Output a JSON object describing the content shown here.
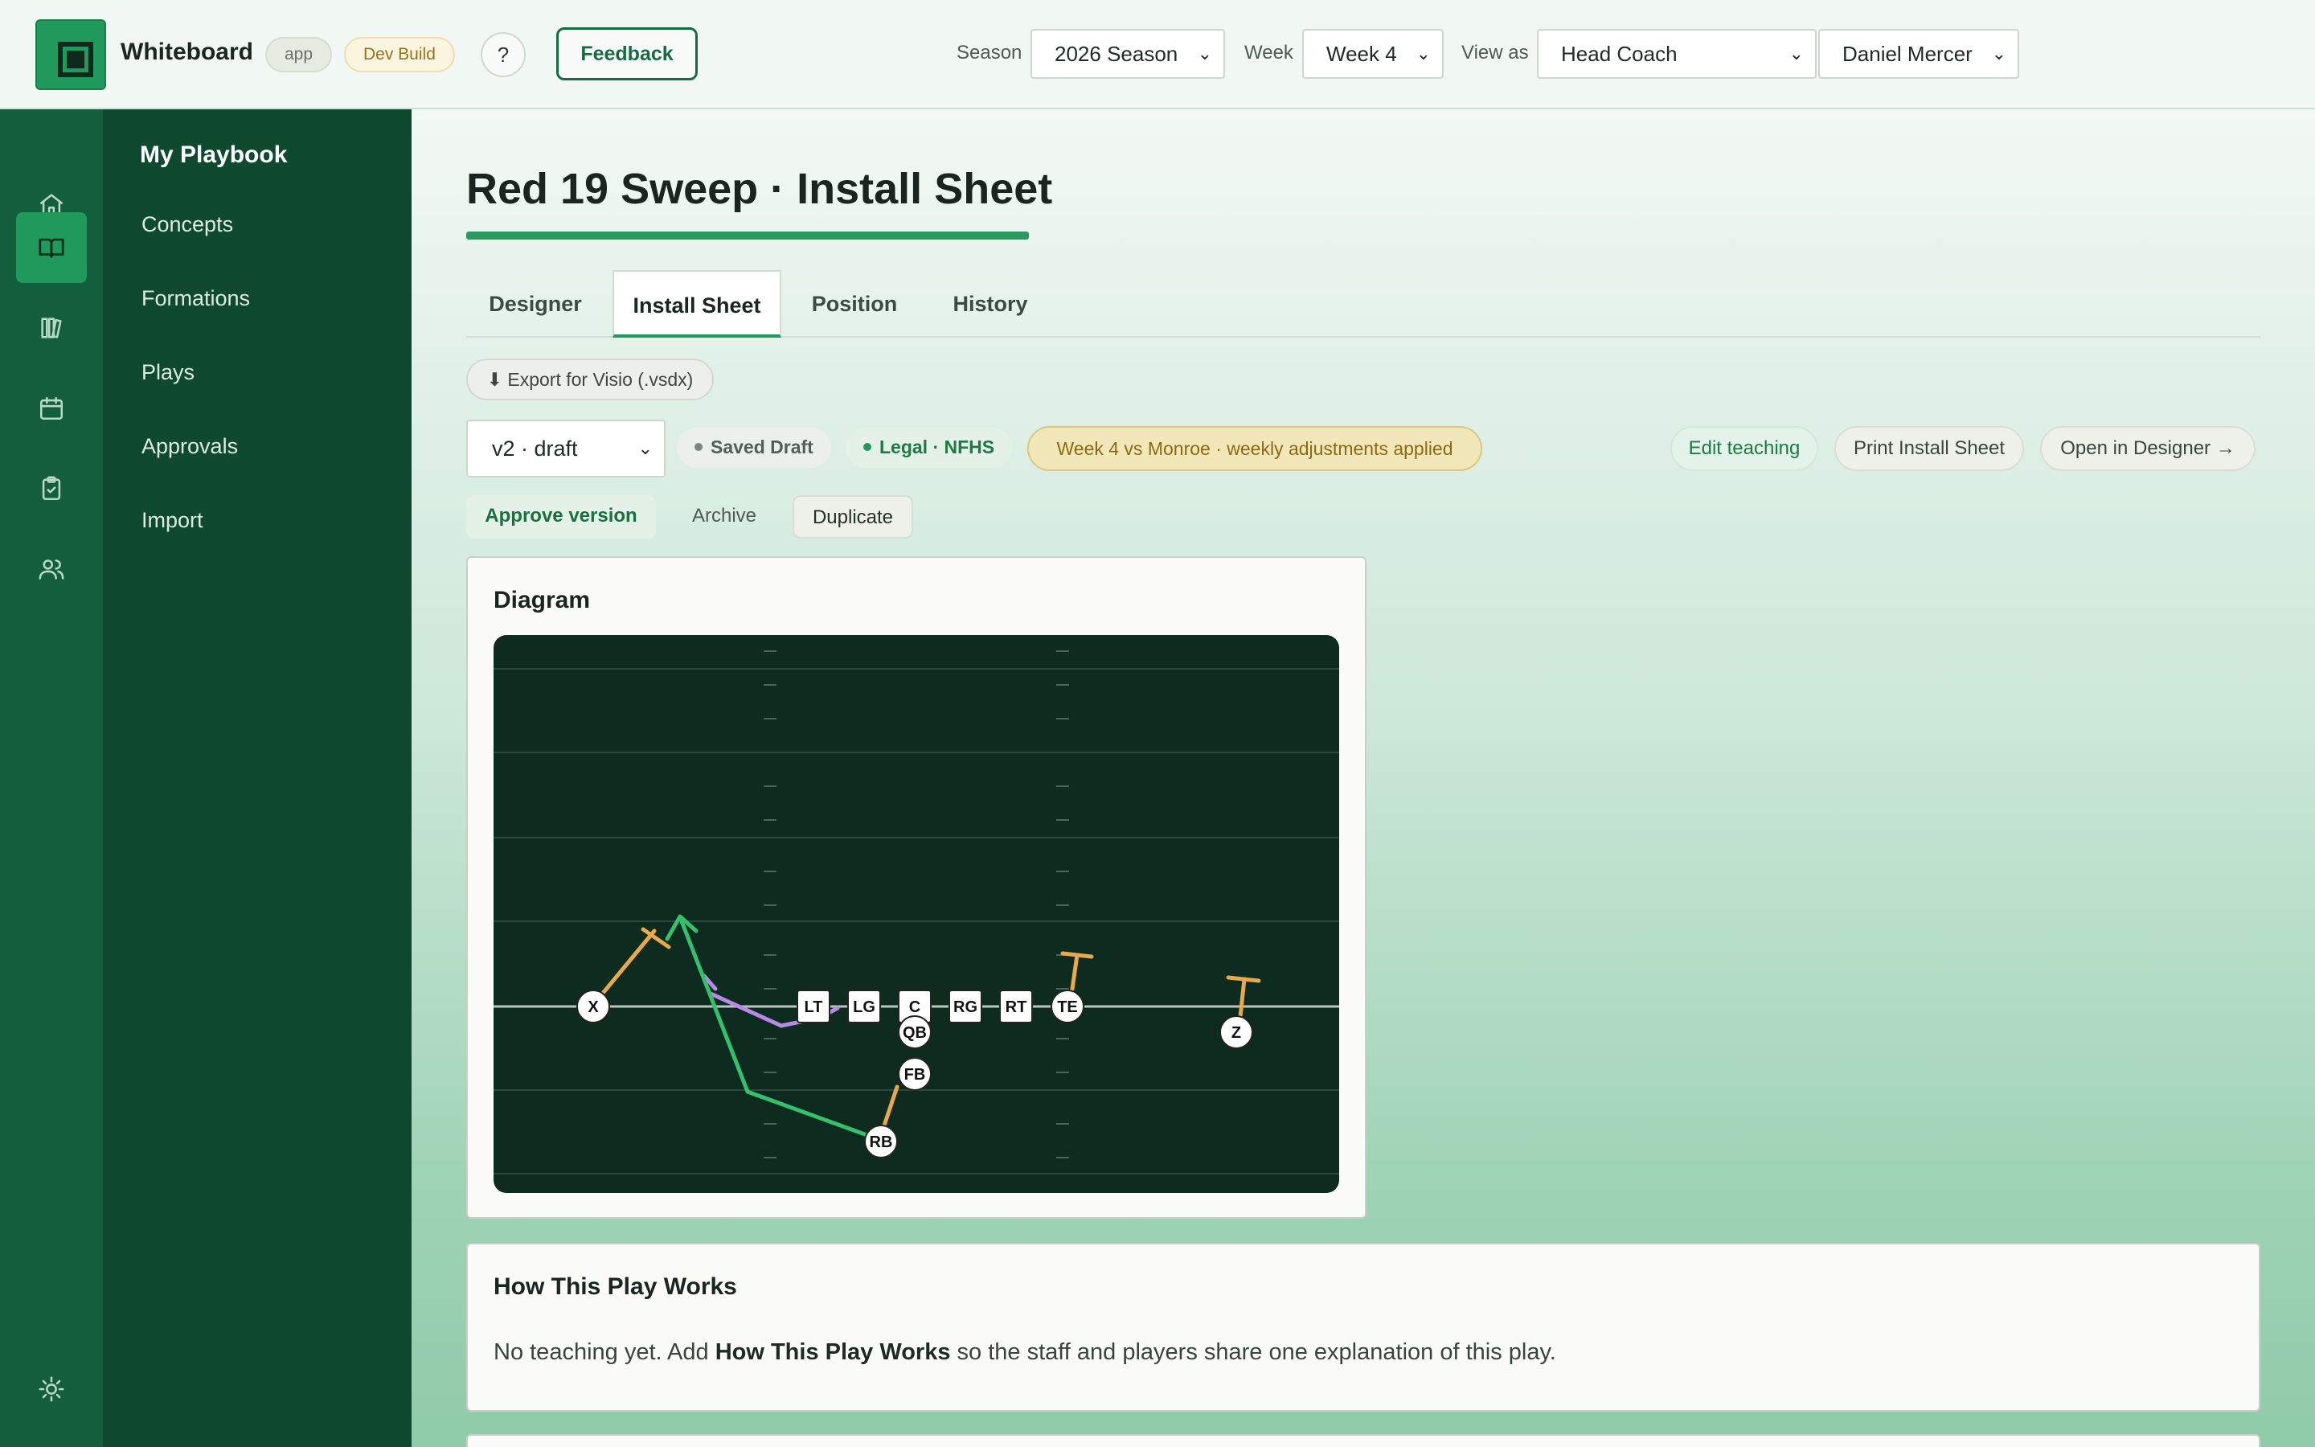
{
  "header": {
    "brand": "Whiteboard",
    "app_tag": "app",
    "build_tag": "Dev Build",
    "help_label": "?",
    "feedback_label": "Feedback",
    "season_label": "Season",
    "season_value": "2026 Season",
    "week_label": "Week",
    "week_value": "Week 4",
    "view_label": "View as",
    "view_value": "Head Coach",
    "user_value": "Daniel Mercer"
  },
  "rail": {
    "icons": [
      "home-icon",
      "book-icon",
      "library-icon",
      "calendar-icon",
      "clipboard-check-icon",
      "users-icon",
      "sun-icon"
    ],
    "active": "book-icon"
  },
  "sidebar": {
    "title": "My Playbook",
    "items": [
      {
        "label": "Concepts"
      },
      {
        "label": "Formations"
      },
      {
        "label": "Plays"
      },
      {
        "label": "Approvals"
      },
      {
        "label": "Import"
      }
    ]
  },
  "main": {
    "title": "Red 19 Sweep · Install Sheet",
    "tabs": [
      {
        "label": "Designer"
      },
      {
        "label": "Install Sheet"
      },
      {
        "label": "Position"
      },
      {
        "label": "History"
      }
    ],
    "active_tab": "Install Sheet",
    "export_label": "⬇ Export for Visio (.vsdx)",
    "version_value": "v2 · draft",
    "saved_badge": "Saved Draft",
    "legal_badge": "Legal · NFHS",
    "notice": "Week 4 vs Monroe · weekly adjustments applied",
    "edit_teaching": "Edit teaching",
    "print_sheet": "Print Install Sheet",
    "open_designer": "Open in Designer →",
    "approve": "Approve version",
    "archive": "Archive",
    "duplicate": "Duplicate",
    "diagram_title": "Diagram",
    "how_title": "How This Play Works",
    "how_text_1": "No teaching yet. Add ",
    "how_text_bold": "How This Play Works",
    "how_text_2": " so the staff and players share one explanation of this play."
  },
  "diagram": {
    "players": [
      {
        "label": "X",
        "shape": "circle"
      },
      {
        "label": "LT",
        "shape": "square"
      },
      {
        "label": "LG",
        "shape": "square"
      },
      {
        "label": "C",
        "shape": "square"
      },
      {
        "label": "RG",
        "shape": "square"
      },
      {
        "label": "RT",
        "shape": "square"
      },
      {
        "label": "TE",
        "shape": "circle"
      },
      {
        "label": "QB",
        "shape": "circle"
      },
      {
        "label": "FB",
        "shape": "circle"
      },
      {
        "label": "RB",
        "shape": "circle"
      },
      {
        "label": "Z",
        "shape": "circle"
      }
    ],
    "colors": {
      "field": "#0e2b1f",
      "block": "#e8a94a",
      "run": "#35c06d",
      "pull": "#b88ae6"
    }
  }
}
